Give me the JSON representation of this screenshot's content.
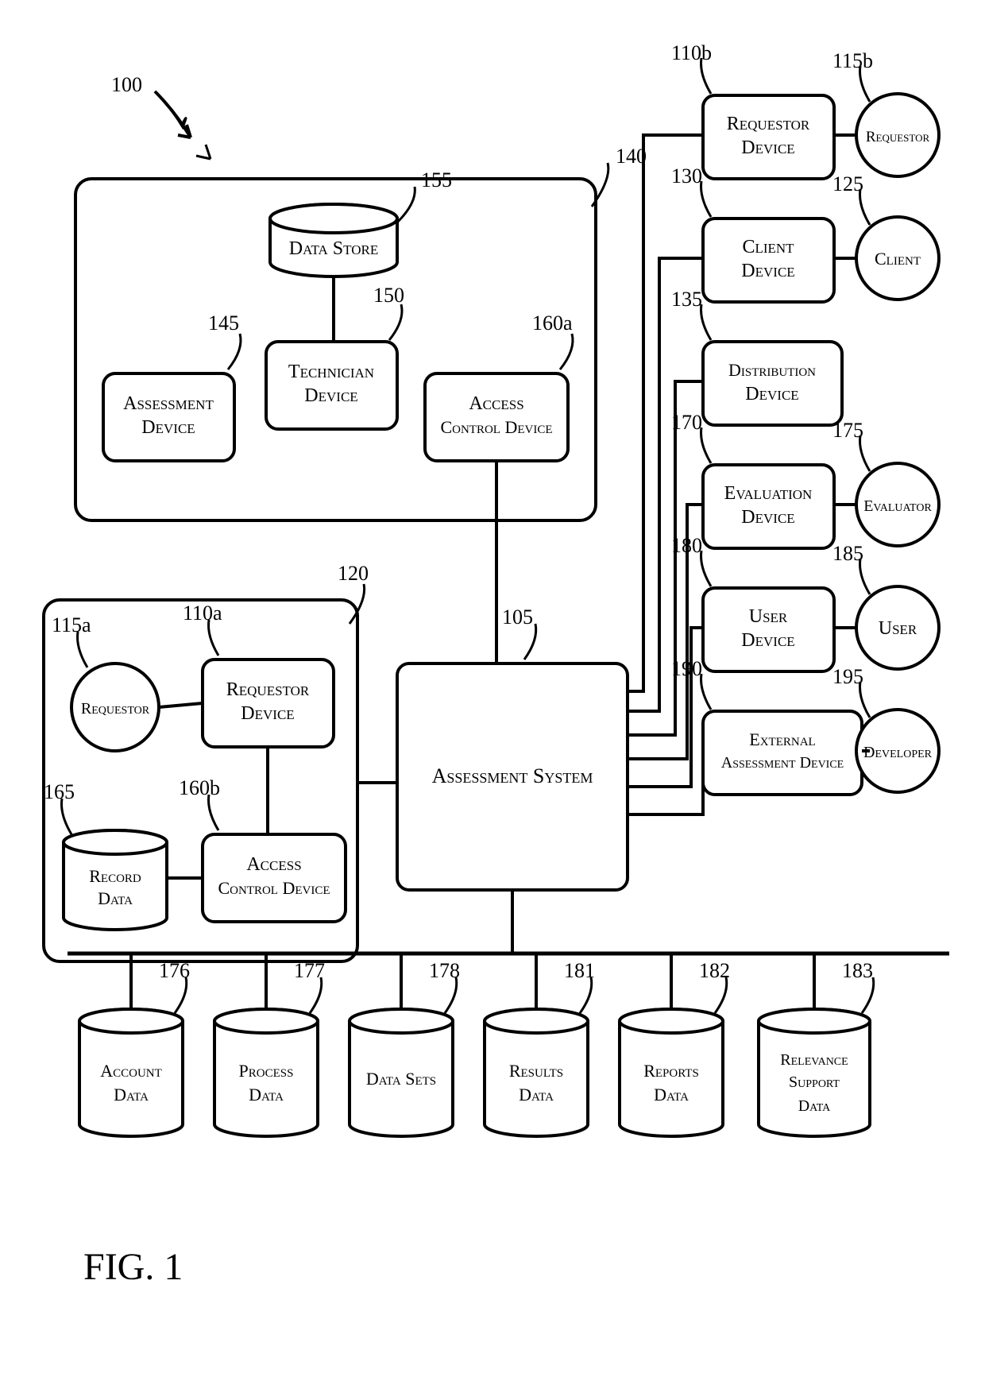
{
  "figure_label": "FIG. 1",
  "system_ref": "100",
  "boxes": {
    "facility140": {
      "ref": "140"
    },
    "data_store": {
      "label": "Data Store",
      "ref": "155"
    },
    "assessment_device": {
      "label1": "Assessment",
      "label2": "Device",
      "ref": "145"
    },
    "technician_device": {
      "label1": "Technician",
      "label2": "Device",
      "ref": "150"
    },
    "access_control_a": {
      "label1": "Access",
      "label2": "Control Device",
      "ref": "160a"
    },
    "facility120": {
      "ref": "120"
    },
    "requestor_a_circle": {
      "label": "Requestor",
      "ref": "115a"
    },
    "requestor_device_a": {
      "label1": "Requestor",
      "label2": "Device",
      "ref": "110a"
    },
    "record_data": {
      "label1": "Record",
      "label2": "Data",
      "ref": "165"
    },
    "access_control_b": {
      "label1": "Access",
      "label2": "Control Device",
      "ref": "160b"
    },
    "assessment_system": {
      "label": "Assessment System",
      "ref": "105"
    },
    "requestor_device_b": {
      "label1": "Requestor",
      "label2": "Device",
      "ref": "110b"
    },
    "requestor_b_circle": {
      "label": "Requestor",
      "ref": "115b"
    },
    "client_device": {
      "label1": "Client",
      "label2": "Device",
      "ref": "130"
    },
    "client_circle": {
      "label": "Client",
      "ref": "125"
    },
    "distribution_device": {
      "label1": "Distribution",
      "label2": "Device",
      "ref": "135"
    },
    "evaluation_device": {
      "label1": "Evaluation",
      "label2": "Device",
      "ref": "170"
    },
    "evaluator_circle": {
      "label": "Evaluator",
      "ref": "175"
    },
    "user_device": {
      "label1": "User",
      "label2": "Device",
      "ref": "180"
    },
    "user_circle": {
      "label": "User",
      "ref": "185"
    },
    "external_device": {
      "label1": "External",
      "label2": "Assessment Device",
      "ref": "190"
    },
    "developer_circle": {
      "label": "Developer",
      "ref": "195"
    }
  },
  "datastores": {
    "account": {
      "label1": "Account",
      "label2": "Data",
      "ref": "176"
    },
    "process": {
      "label1": "Process",
      "label2": "Data",
      "ref": "177"
    },
    "datasets": {
      "label1": "Data Sets",
      "label2": "",
      "ref": "178"
    },
    "results": {
      "label1": "Results",
      "label2": "Data",
      "ref": "181"
    },
    "reports": {
      "label1": "Reports",
      "label2": "Data",
      "ref": "182"
    },
    "relevance": {
      "label1": "Relevance",
      "label2": "Support",
      "label3": "Data",
      "ref": "183"
    }
  }
}
